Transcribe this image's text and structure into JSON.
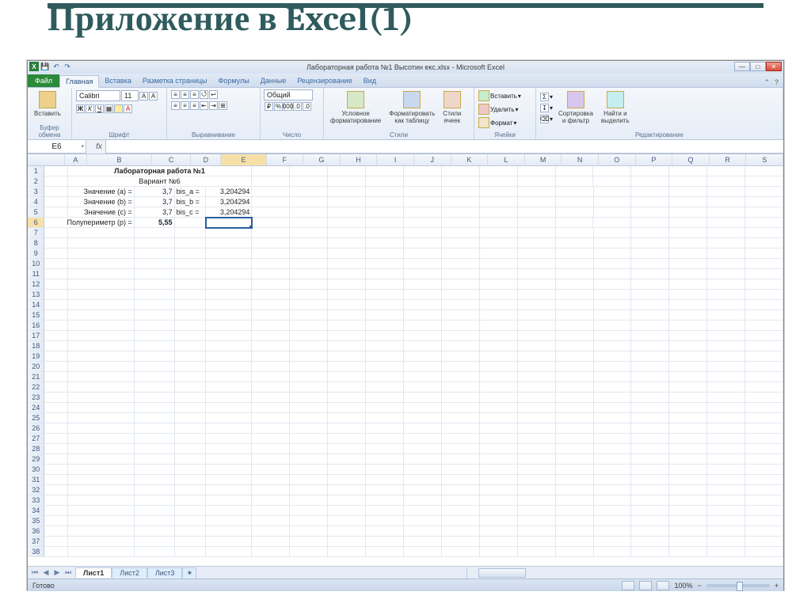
{
  "slide": {
    "title": "Приложение в Excel(1)"
  },
  "window": {
    "title": "Лабораторная работа №1 Высотин екс.xlsx - Microsoft Excel",
    "file_tab": "Файл",
    "tabs": [
      "Главная",
      "Вставка",
      "Разметка страницы",
      "Формулы",
      "Данные",
      "Рецензирование",
      "Вид"
    ]
  },
  "ribbon": {
    "clipboard": {
      "paste": "Вставить",
      "label": "Буфер обмена"
    },
    "font": {
      "name": "Calibri",
      "size": "11",
      "label": "Шрифт"
    },
    "align": {
      "label": "Выравнивание"
    },
    "number": {
      "format": "Общий",
      "label": "Число"
    },
    "styles": {
      "cond": "Условное\nформатирование",
      "table": "Форматировать\nкак таблицу",
      "cell": "Стили\nячеек",
      "label": "Стили"
    },
    "cells": {
      "ins": "Вставить",
      "del": "Удалить",
      "fmt": "Формат",
      "label": "Ячейки"
    },
    "editing": {
      "sort": "Сортировка\nи фильтр",
      "find": "Найти и\nвыделить",
      "label": "Редактирование"
    }
  },
  "name_box": "E6",
  "columns": [
    "A",
    "B",
    "C",
    "D",
    "E",
    "F",
    "G",
    "H",
    "I",
    "J",
    "K",
    "L",
    "M",
    "N",
    "O",
    "P",
    "Q",
    "R",
    "S"
  ],
  "sheet": {
    "r1_title": "Лабораторная работа №1",
    "r2_variant": "Вариант №6",
    "r3": {
      "b": "Значение (a) =",
      "c": "3,7",
      "d": "bis_a =",
      "e": "3,204294"
    },
    "r4": {
      "b": "Значение (b) =",
      "c": "3,7",
      "d": "bis_b =",
      "e": "3,204294"
    },
    "r5": {
      "b": "Значение (c) =",
      "c": "3,7",
      "d": "bis_c =",
      "e": "3,204294"
    },
    "r6": {
      "a": "Полупериметр (p) =",
      "c": "5,55"
    }
  },
  "tabs_sheet": [
    "Лист1",
    "Лист2",
    "Лист3"
  ],
  "status": "Готово",
  "zoom": "100%"
}
